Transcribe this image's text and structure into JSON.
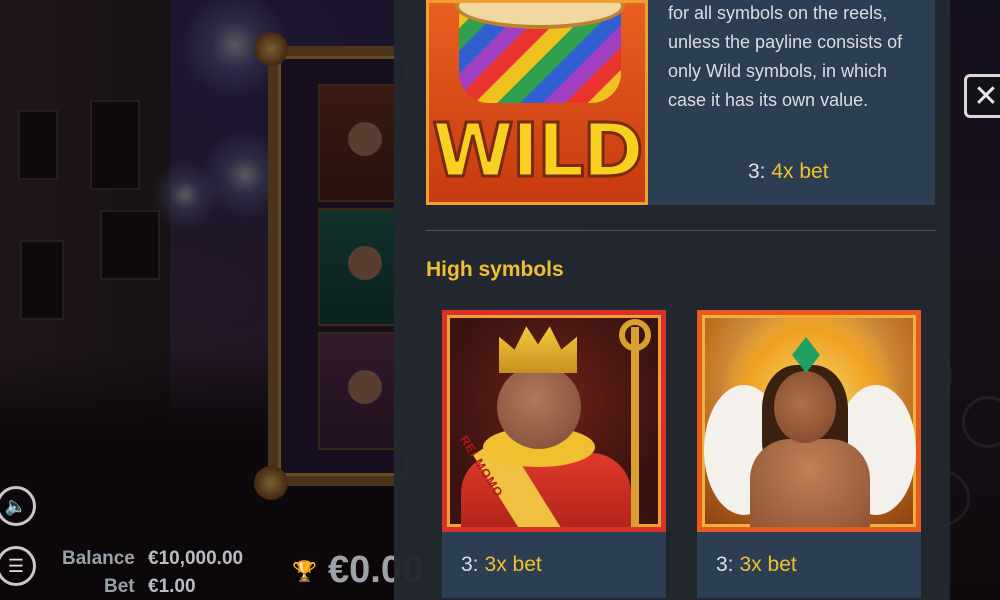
{
  "wild_symbol": {
    "image_text": "WILD",
    "description": "for all symbols on the reels, unless the payline consists of only Wild symbols, in which case it has its own value.",
    "pay": {
      "count": "3:",
      "multiplier": "4x bet"
    }
  },
  "high_symbols": {
    "title": "High symbols",
    "items": [
      {
        "name": "king-momo",
        "sash_text": "REI MOMO",
        "count": "3:",
        "multiplier": "3x bet"
      },
      {
        "name": "samba-dancer",
        "count": "3:",
        "multiplier": "3x bet"
      }
    ]
  },
  "hud": {
    "balance_label": "Balance",
    "balance_value": "€10,000.00",
    "bet_label": "Bet",
    "bet_value": "€1.00",
    "win_value": "€0.00"
  },
  "icons": {
    "close": "close-icon",
    "sound": "speaker-icon",
    "menu": "menu-icon",
    "trophy": "trophy-icon"
  },
  "colors": {
    "accent": "#f0c030",
    "panel_bg": "#232830",
    "card_bg": "#2c3e52"
  }
}
